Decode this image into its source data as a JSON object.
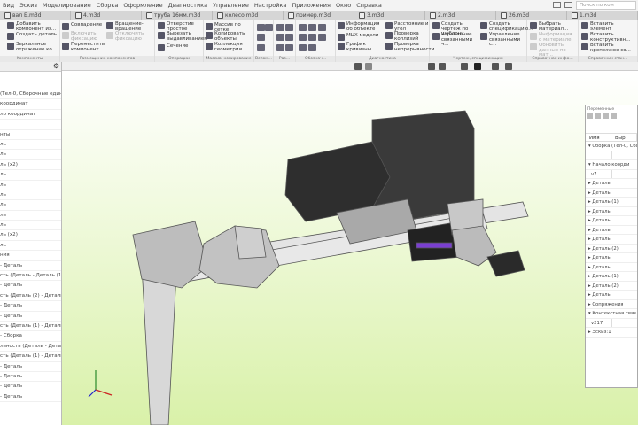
{
  "menu": [
    "Вид",
    "Эскиз",
    "Моделирование",
    "Сборка",
    "Оформление",
    "Диагностика",
    "Управление",
    "Настройка",
    "Приложения",
    "Окно",
    "Справка"
  ],
  "search_placeholder": "Поиск по ком",
  "tabs": [
    "вал Б.m3d",
    "4.m3d",
    "труба 16мм.m3d",
    "колесо.m3d",
    "пример.m3d",
    "3.m3d",
    "2.m3d",
    "26.m3d",
    "1.m3d"
  ],
  "ribbon": {
    "groups": [
      "Компоненты",
      "Размещение компонентов",
      "Операции",
      "Массив, копирование",
      "Вспом...",
      "Раз...",
      "Обознач...",
      "Диагностика",
      "Чертеж, спецификация",
      "Справочная инфо...",
      "Справочник стан..."
    ],
    "commands": {
      "add_component": "Добавить компонент из...",
      "create_part": "Создать деталь",
      "mirror": "Зеркальное отражение ко...",
      "coincidence": "Совпадение",
      "fix_on": "Включить фиксацию",
      "move_component": "Переместить компонент",
      "rotate": "Вращение-вращение",
      "fix_off": "Отключить фиксацию",
      "hole": "Отверстие простое",
      "extrude_cut": "Вырезать выдавливанием",
      "section": "Сечение",
      "grid_array": "Массив по сетке",
      "copy_objects": "Копировать объекты",
      "geometry_collection": "Коллекция геометрии",
      "object_info": "Информация об объекте",
      "mass_props": "МЦХ модели",
      "curvature": "График кривизны",
      "distance": "Расстояние и угол",
      "collisions": "Проверка коллизий",
      "continuity": "Проверка непрерывности",
      "drawing_template": "Создать чертеж по шаблону",
      "linked_drawings": "Управление связанными ч...",
      "create_spec": "Создать спецификацию...",
      "linked_specs": "Управление связанными с...",
      "choose_material": "Выбрать материал...",
      "material_info": "Информация о материале",
      "update_mat": "Обновить данные по мат...",
      "insert_element": "Вставить элемент",
      "insert_construct": "Вставить конструктивн...",
      "insert_fastener": "Вставить крепежное со..."
    }
  },
  "left_tree": [
    "(Тел-0, Сборочные единиц",
    "координат",
    "ло координат",
    "",
    "нты",
    "ль",
    "ль",
    "ль (x2)",
    "ль",
    "ль",
    "ль",
    "ль",
    "ль",
    "ль",
    "ль (x2)",
    "ль",
    "ния",
    "- Деталь",
    "сть (Деталь - Деталь (1))",
    "- Деталь",
    "сть (Деталь (2) - Деталь)",
    "- Деталь",
    "- Деталь",
    "сть (Деталь (1) - Деталь)",
    "- Сборка",
    "льность (Деталь - Детал",
    "сть (Деталь (1) - Деталь)",
    "- Деталь",
    "- Деталь",
    "- Деталь",
    "- Деталь"
  ],
  "variables_panel": {
    "title": "Переменные",
    "col_name": "Имя",
    "col_expr": "Выр",
    "rows": [
      {
        "t": "▾ Сборка (Тел-0, Сбо"
      },
      {
        "v": ""
      },
      {
        "t": "▾ Начало коорди"
      },
      {
        "v": "v7"
      },
      {
        "t": "▸ Деталь"
      },
      {
        "t": "▸ Деталь"
      },
      {
        "t": "▸ Деталь (1)"
      },
      {
        "t": "▸ Деталь"
      },
      {
        "t": "▸ Деталь"
      },
      {
        "t": "▸ Деталь"
      },
      {
        "t": "▸ Деталь"
      },
      {
        "t": "▸ Деталь (2)"
      },
      {
        "t": "▸ Деталь"
      },
      {
        "t": "▸ Деталь"
      },
      {
        "t": "▸ Деталь (1)"
      },
      {
        "t": "▸ Деталь (2)"
      },
      {
        "t": "▸ Деталь"
      },
      {
        "t": "▸ Сопряжения"
      },
      {
        "t": "▾ Контекстная связ"
      },
      {
        "v": "v217"
      },
      {
        "t": "▸ Эскиз:1"
      }
    ]
  },
  "colors": {
    "bg_top": "#ffffff",
    "bg_bottom": "#d9f1a9",
    "part_gray": "#c8c8c8",
    "motor_dark": "#2e2e2e",
    "accent_purple": "#7a3fd0"
  }
}
